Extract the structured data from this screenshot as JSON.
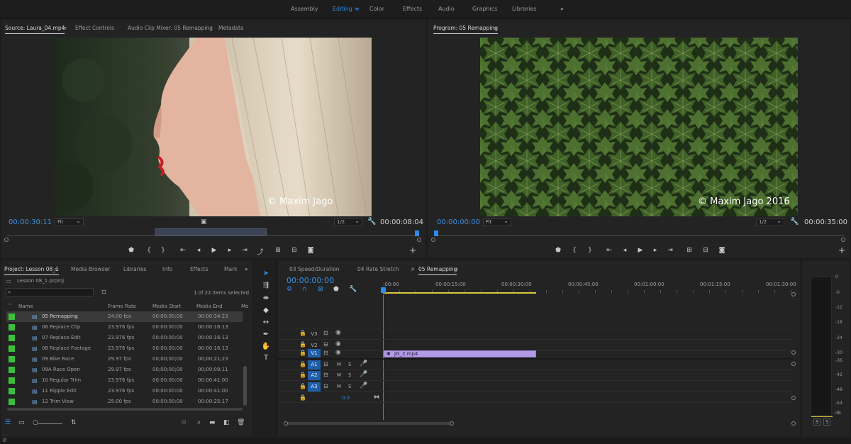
{
  "workspaces": [
    "Assembly",
    "Editing",
    "Color",
    "Effects",
    "Audio",
    "Graphics",
    "Libraries"
  ],
  "workspace_active": "Editing",
  "workspace_more": "»",
  "source": {
    "tabs": [
      "Source: Laura_04.mp4",
      "Effect Controls",
      "Audio Clip Mixer: 05 Remapping",
      "Metadata"
    ],
    "watermark": "© Maxim Jago",
    "timecode_current": "00:00:30:11",
    "fit": "Fit",
    "resolution": "1/2",
    "timecode_duration": "00:00:08:04"
  },
  "program": {
    "tab": "Program: 05 Remapping",
    "watermark": "© Maxim Jago 2016",
    "timecode_current": "00:00:00:00",
    "fit": "Fit",
    "resolution": "1/2",
    "timecode_duration": "00:00:35:00"
  },
  "project": {
    "tabs": [
      "Project: Lesson 08_1",
      "Media Browser",
      "Libraries",
      "Info",
      "Effects",
      "Mark"
    ],
    "file": "Lesson 08_1.prproj",
    "items_selected": "1 of 22 items selected",
    "columns": [
      "Name",
      "Frame Rate",
      "Media Start",
      "Media End",
      "Me"
    ],
    "rows": [
      {
        "name": "05 Remapping",
        "rate": "24.00 fps",
        "start": "00:00:00:00",
        "end": "00:00:34:23"
      },
      {
        "name": "06 Replace Clip",
        "rate": "23.976 fps",
        "start": "00:00:00:00",
        "end": "00:00:16:13"
      },
      {
        "name": "07 Replace Edit",
        "rate": "23.976 fps",
        "start": "00:00:00:00",
        "end": "00:00:16:13"
      },
      {
        "name": "08 Replace Footage",
        "rate": "23.976 fps",
        "start": "00:00:00:00",
        "end": "00:00:16:13"
      },
      {
        "name": "09 Bike Race",
        "rate": "29.97 fps",
        "start": "00;00;00;00",
        "end": "00;00;21;23"
      },
      {
        "name": "09A Race Open",
        "rate": "29.97 fps",
        "start": "00;00;00;00",
        "end": "00;00;09;11"
      },
      {
        "name": "10 Regular Trim",
        "rate": "23.976 fps",
        "start": "00:00:00:00",
        "end": "00:00:41:00"
      },
      {
        "name": "11 Ripple Edit",
        "rate": "23.976 fps",
        "start": "00:00:00:00",
        "end": "00:00:41:00"
      },
      {
        "name": "12 Trim View",
        "rate": "25.00 fps",
        "start": "00:00:00:00",
        "end": "00:00:25:17"
      }
    ]
  },
  "timeline": {
    "tabs": [
      "03 Speed/Duration",
      "04 Rate Stretch",
      "05 Remapping"
    ],
    "close": "×",
    "timecode": "00:00:00:00",
    "ruler": [
      ":00:00",
      "00:00:15:00",
      "00:00:30:00",
      "00:00:45:00",
      "00:01:00:00",
      "00:01:15:00",
      "00:01:30:00"
    ],
    "video_tracks": [
      "V3",
      "V2",
      "V1"
    ],
    "audio_tracks": [
      "A1",
      "A2",
      "A3"
    ],
    "clip": "JG_2.mp4",
    "master_value": "0.0",
    "m": "M",
    "s": "S"
  },
  "meter": {
    "labels": [
      "0",
      "-6",
      "-12",
      "-18",
      "-24",
      "-30",
      "-36",
      "-42",
      "-48",
      "-54",
      "dB"
    ],
    "solo": [
      "S",
      "S"
    ]
  },
  "colors": {
    "accent": "#2d8ceb",
    "label_green": "#3bbf3b",
    "clip_purple": "#b39ae6",
    "track_select": "#1f5fa8"
  }
}
